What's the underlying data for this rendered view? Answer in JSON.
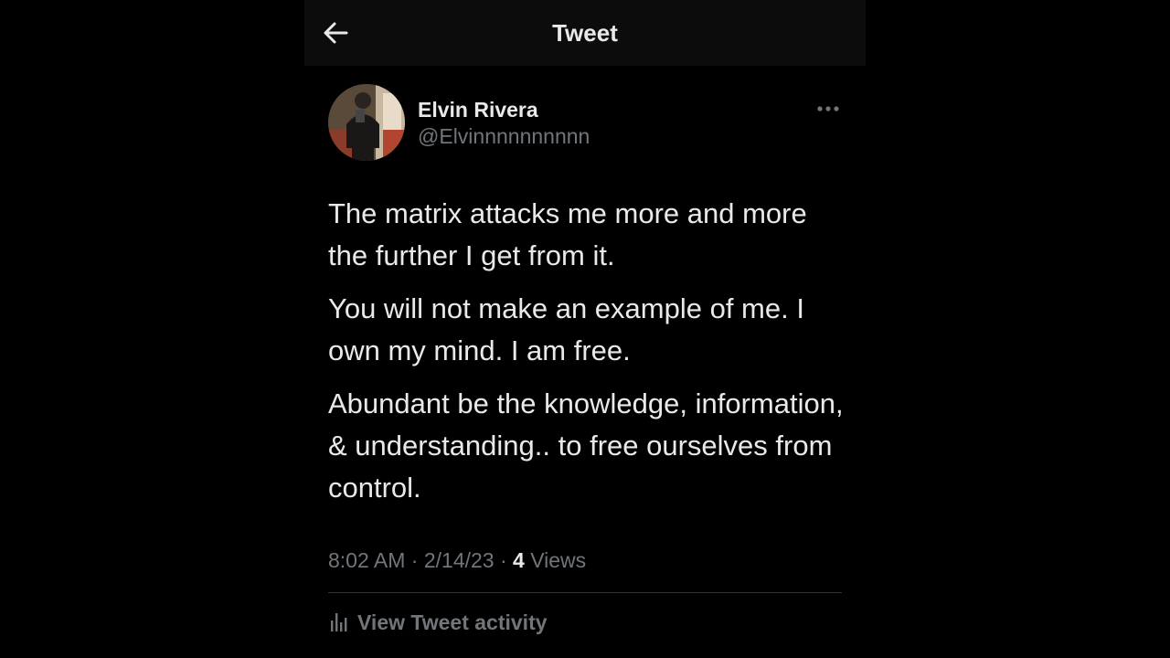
{
  "header": {
    "title": "Tweet",
    "back_icon": "arrow-left-icon"
  },
  "author": {
    "name": "Elvin Rivera",
    "handle": "@Elvinnnnnnnnnn",
    "avatar_icon": "avatar-photo"
  },
  "tweet": {
    "paragraphs": [
      "The matrix attacks me more and more the further I get from it.",
      "You will not make an example of me. I own my mind. I am free.",
      "Abundant be the knowledge, information, & understanding.. to free ourselves from control."
    ],
    "time": "8:02 AM",
    "date": "2/14/23",
    "separator": "·",
    "views_count": "4",
    "views_label": "Views"
  },
  "activity": {
    "label": "View Tweet activity",
    "icon": "analytics-icon"
  },
  "colors": {
    "background": "#000000",
    "header_background": "#0c0c0c",
    "text": "#e7e9ea",
    "secondary_text": "#71767b",
    "divider": "#2f3336"
  }
}
